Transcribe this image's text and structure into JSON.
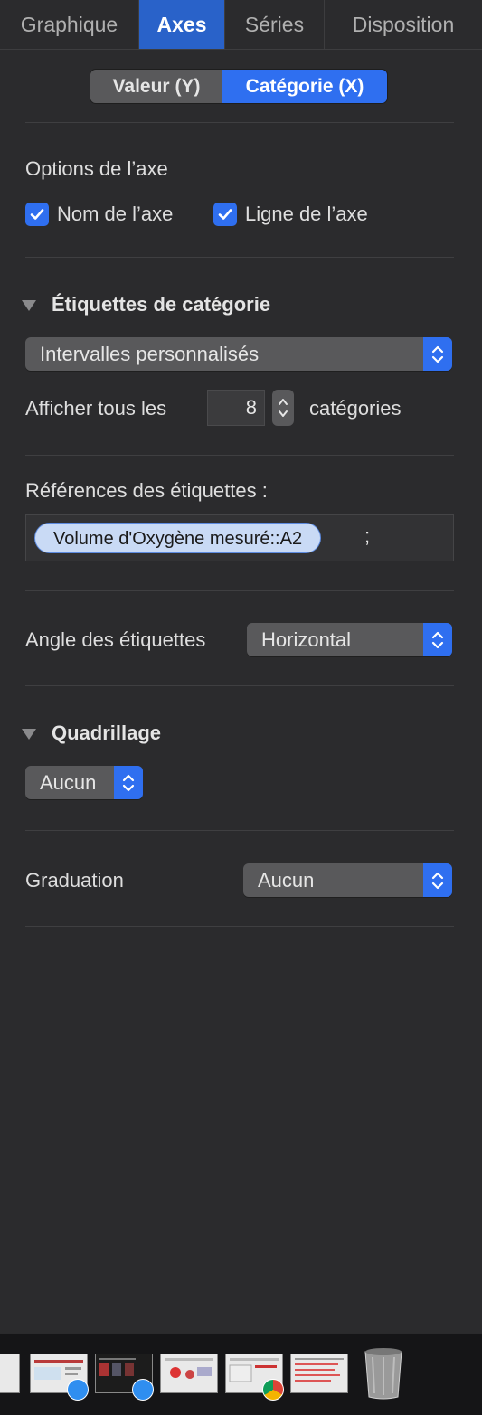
{
  "tabs": [
    {
      "label": "Graphique",
      "active": false
    },
    {
      "label": "Axes",
      "active": true
    },
    {
      "label": "Séries",
      "active": false
    },
    {
      "label": "Disposition",
      "active": false
    }
  ],
  "axis_segment": {
    "y_label": "Valeur (Y)",
    "x_label": "Catégorie (X)",
    "selected": "Catégorie (X)"
  },
  "axis_options": {
    "heading": "Options de l’axe",
    "axis_name": {
      "label": "Nom de l’axe",
      "checked": true
    },
    "axis_line": {
      "label": "Ligne de l’axe",
      "checked": true
    }
  },
  "category_labels": {
    "heading": "Étiquettes de catégorie",
    "interval_mode": "Intervalles personnalisés",
    "show_every_prefix": "Afficher tous les",
    "show_every_value": "8",
    "show_every_suffix": "catégories"
  },
  "label_refs": {
    "heading": "Références des étiquettes :",
    "token": "Volume d'Oxygène mesuré::A2",
    "separator": ";"
  },
  "label_angle": {
    "label": "Angle des étiquettes",
    "value": "Horizontal"
  },
  "gridlines": {
    "heading": "Quadrillage",
    "value": "Aucun"
  },
  "tick_marks": {
    "label": "Graduation",
    "value": "Aucun"
  },
  "colors": {
    "accent": "#2f6ff0",
    "tab_active": "#2962c9",
    "panel": "#2b2b2d"
  }
}
